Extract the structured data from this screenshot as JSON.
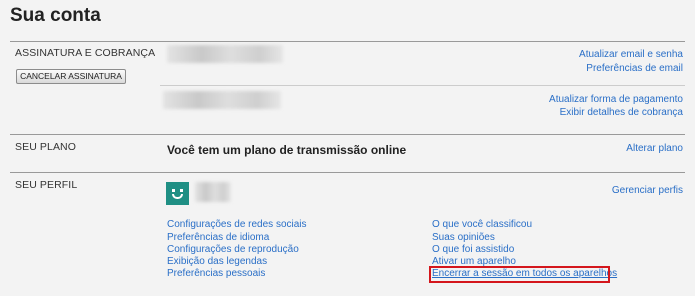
{
  "page": {
    "title": "Sua conta"
  },
  "billing": {
    "label": "ASSINATURA E COBRANÇA",
    "cancel_button": "CANCELAR ASSINATURA",
    "links_top": [
      "Atualizar email e senha",
      "Preferências de email"
    ],
    "links_bottom": [
      "Atualizar forma de pagamento",
      "Exibir detalhes de cobrança"
    ]
  },
  "plan": {
    "label": "SEU PLANO",
    "text": "Você tem um plano de transmissão online",
    "link": "Alterar plano"
  },
  "profile": {
    "label": "SEU PERFIL",
    "manage_link": "Gerenciar perfis",
    "left_links": [
      "Configurações de redes sociais",
      "Preferências de idioma",
      "Configurações de reprodução",
      "Exibição das legendas",
      "Preferências pessoais"
    ],
    "right_links": [
      "O que você classificou",
      "Suas opiniões",
      "O que foi assistido",
      "Ativar um aparelho",
      "Encerrar a sessão em todos os aparelhos"
    ]
  },
  "colors": {
    "link": "#2a6fc7",
    "highlight": "#d4161c",
    "avatar": "#1f8f84",
    "background": "#f3f3f3"
  },
  "icons": {
    "avatar": "smiley-avatar-icon"
  }
}
